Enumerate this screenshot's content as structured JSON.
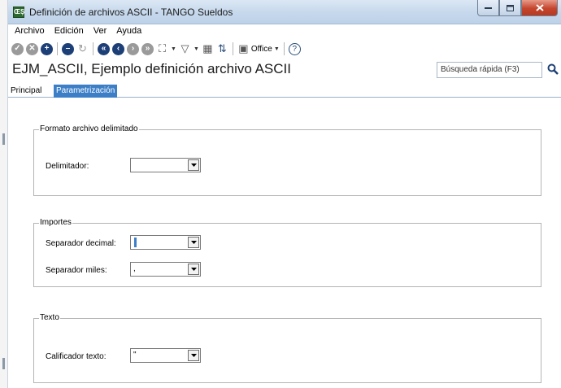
{
  "window": {
    "title": "Definición de archivos ASCII - TANGO Sueldos",
    "buttons": {
      "minimize": "–",
      "maximize": "□",
      "close": "✕"
    }
  },
  "menu": [
    {
      "label": "Archivo"
    },
    {
      "label": "Edición"
    },
    {
      "label": "Ver"
    },
    {
      "label": "Ayuda"
    }
  ],
  "toolbar": {
    "icons": [
      "check-icon",
      "cancel-icon",
      "add-icon",
      "remove-icon",
      "refresh-icon",
      "first-icon",
      "previous-icon",
      "next-icon",
      "last-icon",
      "binoculars-icon",
      "filter-icon",
      "grid-icon",
      "sort-icon",
      "office-icon",
      "help-icon"
    ],
    "office_label": "Office"
  },
  "header": {
    "title": "EJM_ASCII, Ejemplo definición archivo ASCII",
    "search_label": "Búsqueda rápida (F3)"
  },
  "tabs": [
    {
      "label": "Principal",
      "active": false
    },
    {
      "label": "Parametrización",
      "active": true
    }
  ],
  "groups": {
    "delimitado": {
      "title": "Formato archivo delimitado",
      "delimitador_label": "Delimitador:",
      "delimitador_value": ""
    },
    "importes": {
      "title": "Importes",
      "decimal_label": "Separador decimal:",
      "decimal_value": "",
      "miles_label": "Separador miles:",
      "miles_value": ","
    },
    "texto": {
      "title": "Texto",
      "calificador_label": "Calificador texto:",
      "calificador_value": "\""
    }
  },
  "colors": {
    "accent": "#3c7fc7",
    "titlebar": "#c6d8ec",
    "close_button": "#c4452d"
  }
}
